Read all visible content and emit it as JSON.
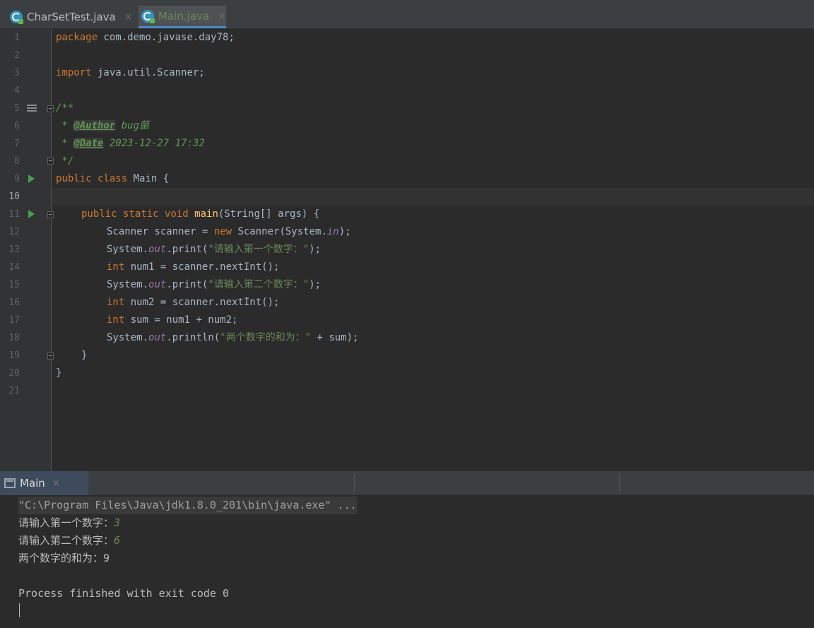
{
  "tabs": [
    {
      "label": "CharSetTest.java",
      "close": "×",
      "icon": "java-class-icon",
      "active": false
    },
    {
      "label": "Main.java",
      "close": "×",
      "icon": "java-class-icon",
      "active": true
    }
  ],
  "editor": {
    "line_numbers": [
      "1",
      "2",
      "3",
      "4",
      "5",
      "6",
      "7",
      "8",
      "9",
      "10",
      "11",
      "12",
      "13",
      "14",
      "15",
      "16",
      "17",
      "18",
      "19",
      "20",
      "21"
    ],
    "current_line": 10,
    "lines": {
      "l1": {
        "kw": "package",
        "rest": " com.demo.javase.day78;"
      },
      "l3": {
        "kw": "import",
        "rest": " java.util.Scanner;"
      },
      "l5": "/**",
      "l6": {
        "prefix": " * ",
        "tag": "@Author",
        "text": " bug菌"
      },
      "l7": {
        "prefix": " * ",
        "tag": "@Date",
        "text": " 2023-12-27 17:32"
      },
      "l8": " */",
      "l9": {
        "kw": "public class",
        "name": " Main {"
      },
      "l11": {
        "kw": "public static void",
        "fn": "main",
        "rest": "(String[] args) {"
      },
      "l12": {
        "a": "Scanner scanner = ",
        "kw": "new",
        "b": " Scanner(System.",
        "fld": "in",
        "c": ");"
      },
      "l13": {
        "a": "System.",
        "fld": "out",
        "b": ".print(",
        "str": "\"请输入第一个数字：\"",
        "c": ");"
      },
      "l14": {
        "kw": "int",
        "rest": " num1 = scanner.nextInt();"
      },
      "l15": {
        "a": "System.",
        "fld": "out",
        "b": ".print(",
        "str": "\"请输入第二个数字：\"",
        "c": ");"
      },
      "l16": {
        "kw": "int",
        "rest": " num2 = scanner.nextInt();"
      },
      "l17": {
        "kw": "int",
        "rest": " sum = num1 + num2;"
      },
      "l18": {
        "a": "System.",
        "fld": "out",
        "b": ".println(",
        "str": "\"两个数字的和为：\"",
        "c": " + sum);"
      },
      "l19": "}",
      "l20": "}"
    }
  },
  "run_panel": {
    "tab_label": "Main",
    "tab_close": "×",
    "console": {
      "command": "\"C:\\Program Files\\Java\\jdk1.8.0_201\\bin\\java.exe\" ...",
      "prompt1": "请输入第一个数字：",
      "input1": "3",
      "prompt2": "请输入第二个数字：",
      "input2": "6",
      "result": "两个数字的和为：9",
      "exit": "Process finished with exit code 0"
    }
  },
  "colors": {
    "background": "#2b2b2b",
    "keyword": "#cc7832",
    "string": "#6a8759",
    "function": "#ffc66d",
    "field": "#9876aa",
    "comment": "#629755"
  }
}
